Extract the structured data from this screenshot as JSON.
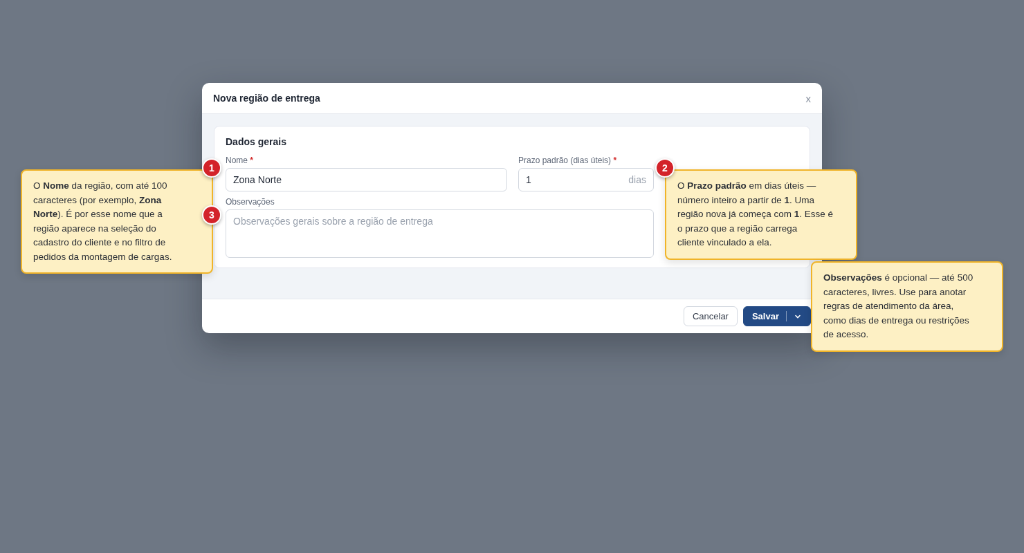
{
  "dialog": {
    "title": "Nova região de entrega",
    "close": "x",
    "section": {
      "title": "Dados gerais",
      "fields": [
        {
          "kind": "text",
          "label": "Nome",
          "required_mark": "*",
          "value": "Zona Norte"
        },
        {
          "kind": "number",
          "label": "Prazo padrão (dias úteis)",
          "required_mark": "*",
          "value": "1",
          "suffix": "dias"
        },
        {
          "kind": "textarea",
          "label": "Observações",
          "placeholder": "Observações gerais sobre a região de entrega"
        }
      ]
    },
    "buttons": [
      {
        "kind": "secondary",
        "label": "Cancelar"
      },
      {
        "kind": "primary",
        "label": "Salvar",
        "menu": true
      }
    ]
  },
  "annotations": [
    {
      "number": "1",
      "lines": [
        "O **Nome** da região, com até 100",
        "caracteres (por exemplo, **Zona**",
        "**Norte**). É por esse nome que a",
        "região aparece na seleção do",
        "cadastro do cliente e no filtro de",
        "pedidos da montagem de cargas."
      ]
    },
    {
      "number": "2",
      "lines": [
        "O **Prazo padrão** em dias úteis —",
        "número inteiro a partir de **1**. Uma",
        "região nova já começa com **1**. Esse é",
        "o prazo que a região carrega",
        "cliente vinculado a ela."
      ]
    },
    {
      "number": "3",
      "lines": [
        "**Observações** é opcional — até 500",
        "caracteres, livres. Use para anotar",
        "regras de atendimento da área,",
        "como dias de entrega ou restrições",
        "de acesso."
      ]
    }
  ]
}
